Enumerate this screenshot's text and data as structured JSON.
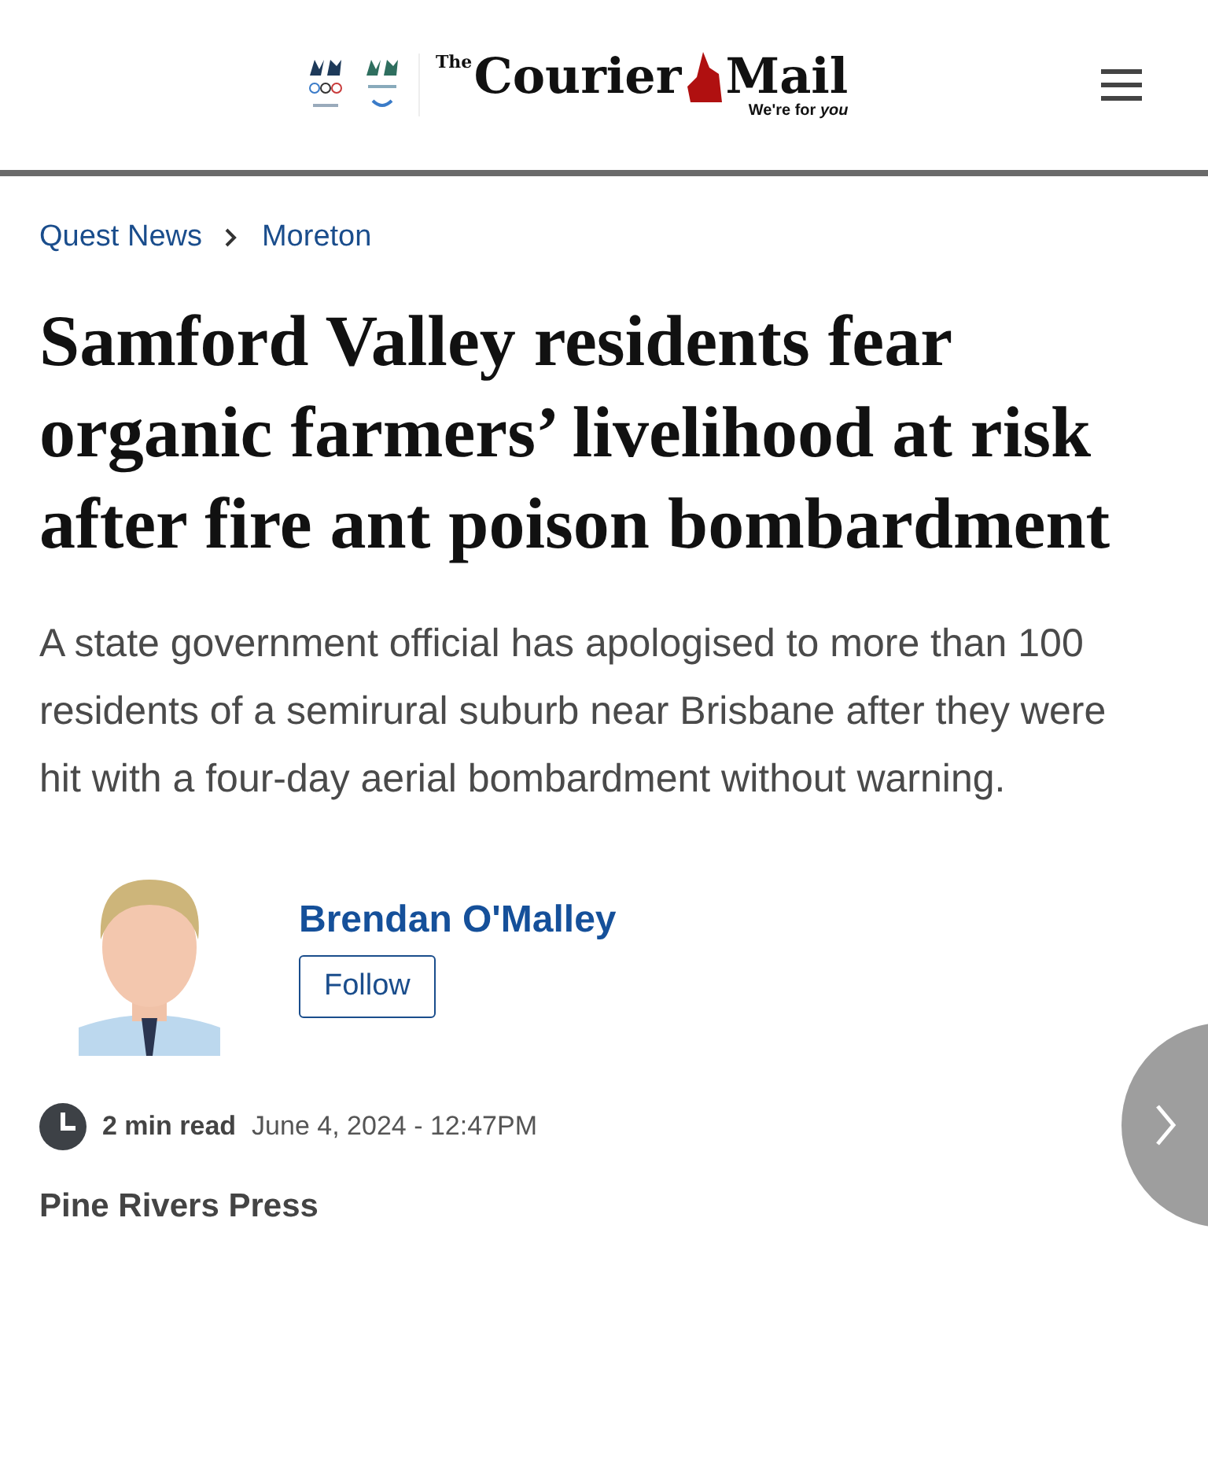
{
  "header": {
    "logo_small": "The",
    "logo": "Courier",
    "logo_2": "Mail",
    "tagline": "We're for",
    "tagline_script": "you"
  },
  "breadcrumbs": [
    {
      "label": "Quest News"
    },
    {
      "label": "Moreton"
    }
  ],
  "headline": "Samford Valley residents fear organic farmers’ livelihood at risk after fire ant poison bombardment",
  "standfirst": "A state government official has apologised to more than 100 residents of a semirural suburb near Brisbane after they were hit with a four-day aerial bombardment without warning.",
  "author": {
    "name": "Brendan O'Malley",
    "follow": "Follow"
  },
  "meta": {
    "read_time": "2 min read",
    "date": "June 4, 2024 - 12:47PM"
  },
  "masthead": "Pine Rivers Press"
}
